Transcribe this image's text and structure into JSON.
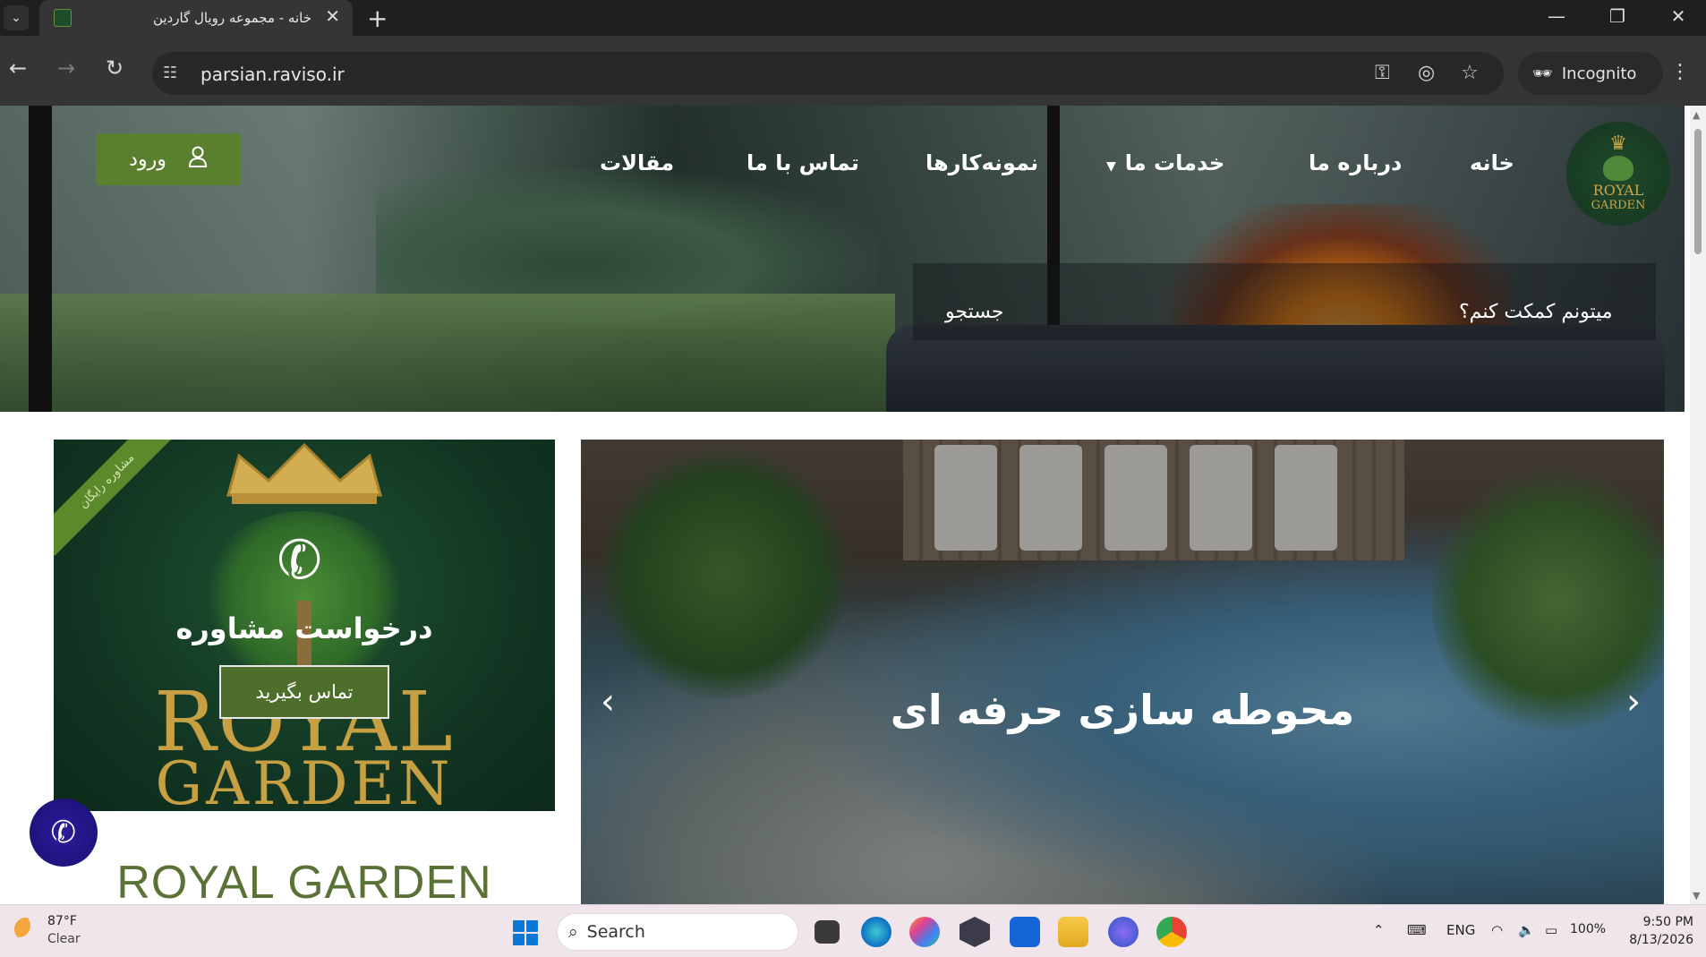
{
  "browser": {
    "tab_title": "خانه - مجموعه رویال گاردین",
    "url": "parsian.raviso.ir",
    "incognito_label": "Incognito",
    "new_tab_symbol": "+",
    "close_symbol": "✕"
  },
  "site": {
    "logo": {
      "line1": "ROYAL",
      "line2": "GARDEN"
    },
    "menu": [
      {
        "label": "خانه"
      },
      {
        "label": "درباره ما"
      },
      {
        "label": "خدمات ما",
        "has_dropdown": true
      },
      {
        "label": "نمونه‌کارها"
      },
      {
        "label": "تماس با ما"
      },
      {
        "label": "مقالات"
      }
    ],
    "login_label": "ورود",
    "help_text": "میتونم کمکت کنم؟",
    "search_label": "جستجو"
  },
  "consult_card": {
    "ribbon": "مشاوره رایگان",
    "title": "درخواست مشاوره",
    "button": "تماس بگیرید",
    "logo_line1": "ROYAL",
    "logo_line2": "GARDEN"
  },
  "brand_text": "ROYAL GARDEN",
  "slider": {
    "title": "محوطه سازی حرفه ای"
  },
  "taskbar": {
    "weather_temp": "87°F",
    "weather_cond": "Clear",
    "search_label": "Search",
    "lang": "ENG",
    "battery": "100%",
    "time": "9:50 PM",
    "date": "8/13/2026"
  },
  "colors": {
    "accent_green": "#5a7f2e",
    "brand_gold": "#c7a043",
    "brand_text_green": "#5a7236",
    "call_button": "#1a0f70"
  }
}
